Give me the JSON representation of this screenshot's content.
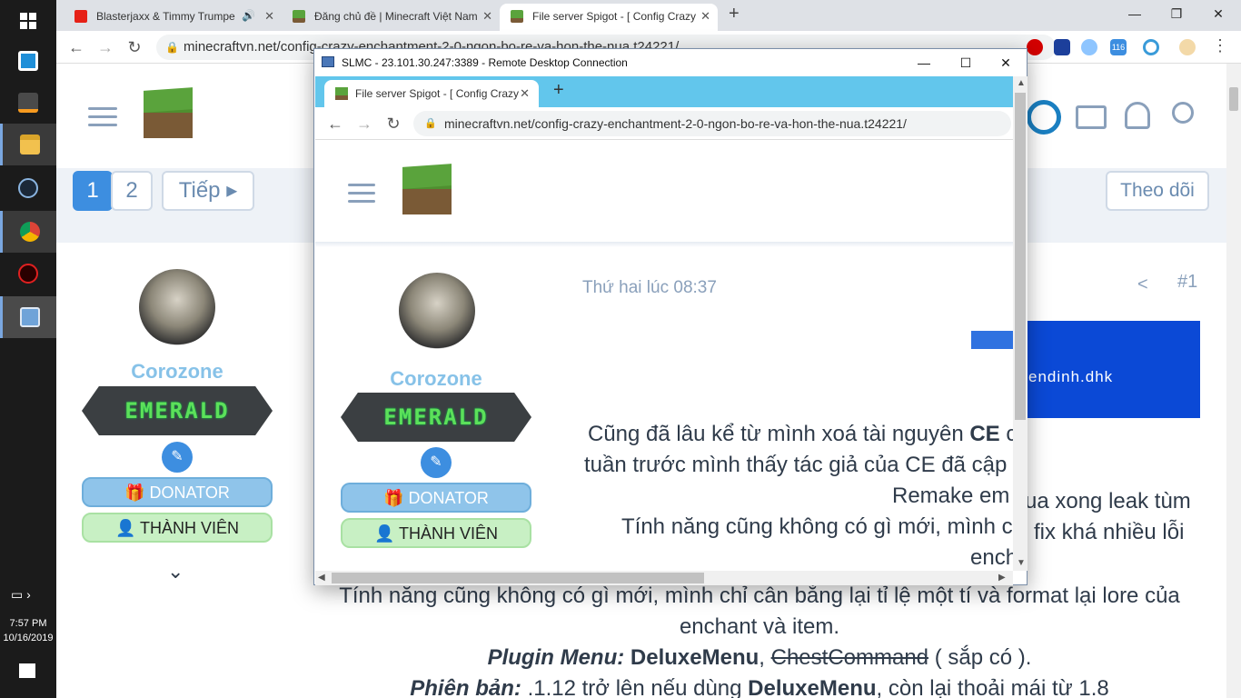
{
  "taskbar": {
    "icons": [
      "windows-start",
      "app-blue-square",
      "sublime-text",
      "file-explorer",
      "steam",
      "chrome",
      "garena",
      "remote-desktop"
    ],
    "clock_time": "7:57 PM",
    "clock_date": "10/16/2019"
  },
  "outer_browser": {
    "tabs": [
      {
        "title": "Blasterjaxx & Timmy Trumpe",
        "icon": "youtube-icon",
        "audio": true
      },
      {
        "title": "Đăng chủ đề | Minecraft Việt Nam",
        "icon": "minecraft-grass-icon"
      },
      {
        "title": "File server Spigot - [ Config Crazy",
        "icon": "minecraft-grass-icon",
        "active": true
      }
    ],
    "new_tab": "+",
    "url": "minecraftvn.net/config-crazy-enchantment-2-0-ngon-bo-re-va-hon-the-nua.t24221/",
    "win_minimize": "—",
    "win_restore": "❐",
    "win_close": "✕",
    "ext_badge": "116"
  },
  "outer_page": {
    "pagination": {
      "pages": [
        "1",
        "2"
      ],
      "next": "Tiếp"
    },
    "follow_button": "Theo dõi",
    "post_number": "#1",
    "user": {
      "name": "Corozone",
      "rank_banner": "EMERALD",
      "donator": "DONATOR",
      "member": "THÀNH VIÊN"
    },
    "image_caption": "endinh.dhk",
    "text_lines": [
      "ua xong leak tùm",
      "fix khá nhiều lỗi",
      "Tính năng cũng không có gì mới, mình chỉ cân bằng lại tỉ lệ một tí và format lại lore của",
      "enchant và item."
    ],
    "plugin_menu_label": "Plugin Menu:",
    "plugin_menu_value": "DeluxeMenu",
    "plugin_menu_sep": ",",
    "plugin_menu_struck": "ChestCommand",
    "plugin_menu_soon": " ( sắp có ).",
    "version_label": "Phiên bản:",
    "version_pre": " .1.12 trở lên nếu dùng ",
    "version_bold": "DeluxeMenu",
    "version_post": ", còn lại thoải mái từ 1.8"
  },
  "rdp_window": {
    "title": "SLMC - 23.101.30.247:3389 - Remote Desktop Connection",
    "inner_tab_title": "File server Spigot - [ Config Crazy",
    "inner_url": "minecraftvn.net/config-crazy-enchantment-2-0-ngon-bo-re-va-hon-the-nua.t24221/",
    "post_time": "Thứ hai lúc 08:37",
    "user": {
      "name": "Corozone",
      "rank_banner": "EMERALD",
      "donator": "DONATOR",
      "member": "THÀNH VIÊN"
    },
    "text_line1_pre": "Cũng đã lâu kể từ mình xoá tài nguyên ",
    "text_line1_bold": "CE",
    "text_line1_post": " c",
    "text_line2": "tuần trước mình thấy tác giả của CE đã cập n",
    "text_line3": "Remake em",
    "text_line4": "Tính năng cũng không có gì mới, mình c",
    "text_line5": "ench"
  }
}
